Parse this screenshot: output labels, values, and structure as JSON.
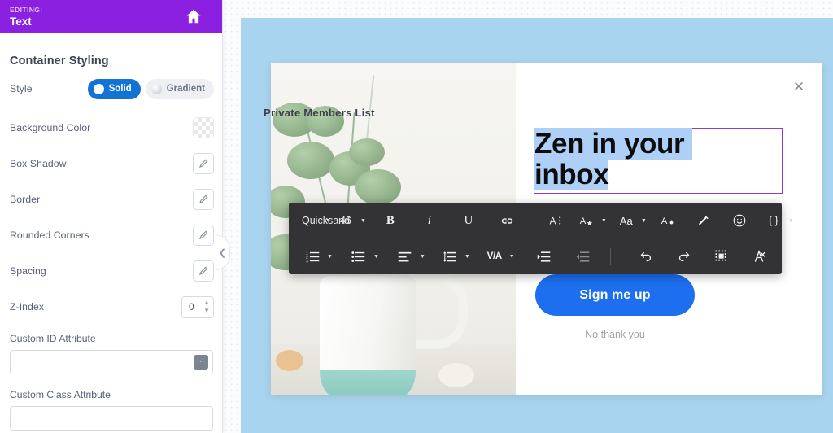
{
  "sidebar": {
    "header": {
      "editing_label": "EDITING:",
      "editing_value": "Text",
      "home_icon": "home-icon"
    },
    "panel_title": "Container Styling",
    "style_row": {
      "label": "Style",
      "options": [
        {
          "label": "Solid",
          "active": true
        },
        {
          "label": "Gradient",
          "active": false
        }
      ]
    },
    "rows": [
      {
        "label": "Background Color",
        "control": "color-swatch"
      },
      {
        "label": "Box Shadow",
        "control": "pencil-icon"
      },
      {
        "label": "Border",
        "control": "pencil-icon"
      },
      {
        "label": "Rounded Corners",
        "control": "pencil-icon"
      },
      {
        "label": "Spacing",
        "control": "pencil-icon"
      }
    ],
    "zindex": {
      "label": "Z-Index",
      "value": "0"
    },
    "custom_id": {
      "label": "Custom ID Attribute",
      "value": "",
      "placeholder": ""
    },
    "custom_class": {
      "label": "Custom Class Attribute",
      "value": "",
      "placeholder": ""
    },
    "collapse_icon": "chevron-left-icon"
  },
  "modal": {
    "close_icon": "close-icon",
    "eyebrow": "Private Members List",
    "headline_selected": "Zen in your inbox",
    "cta_label": "Sign me up",
    "decline_label": "No thank you"
  },
  "toolbar": {
    "font_family": "Quicksand",
    "font_size": "46",
    "row1": [
      {
        "name": "bold-button",
        "glyph": "B"
      },
      {
        "name": "italic-button",
        "glyph": "i"
      },
      {
        "name": "underline-button",
        "glyph": "U"
      },
      {
        "name": "link-icon",
        "glyph": "⎆"
      },
      {
        "name": "font-color-icon",
        "glyph": "A"
      },
      {
        "name": "text-style-icon",
        "glyph": "A"
      },
      {
        "name": "text-case-icon",
        "glyph": "Aa"
      },
      {
        "name": "text-fill-icon",
        "glyph": "A"
      },
      {
        "name": "highlighter-icon",
        "glyph": "✐"
      },
      {
        "name": "emoji-icon",
        "glyph": "☺"
      },
      {
        "name": "merge-tag-icon",
        "glyph": "{ }"
      }
    ],
    "row2": [
      {
        "name": "numbered-list-icon"
      },
      {
        "name": "bulleted-list-icon"
      },
      {
        "name": "align-icon"
      },
      {
        "name": "line-height-icon"
      },
      {
        "name": "letter-spacing-icon",
        "glyph": "V/A"
      },
      {
        "name": "indent-increase-icon"
      },
      {
        "name": "indent-decrease-icon"
      },
      {
        "name": "undo-icon"
      },
      {
        "name": "redo-icon"
      },
      {
        "name": "select-all-icon"
      },
      {
        "name": "clear-formatting-icon"
      }
    ]
  },
  "colors": {
    "brand_purple": "#8b20e0",
    "accent_blue": "#1273d4",
    "cta_blue": "#1d6fef",
    "canvas_blue": "#a8d4ef",
    "toolbar_dark": "#333335",
    "selection_blue": "#aed0f7",
    "selection_border_purple": "#8a3fd1"
  }
}
